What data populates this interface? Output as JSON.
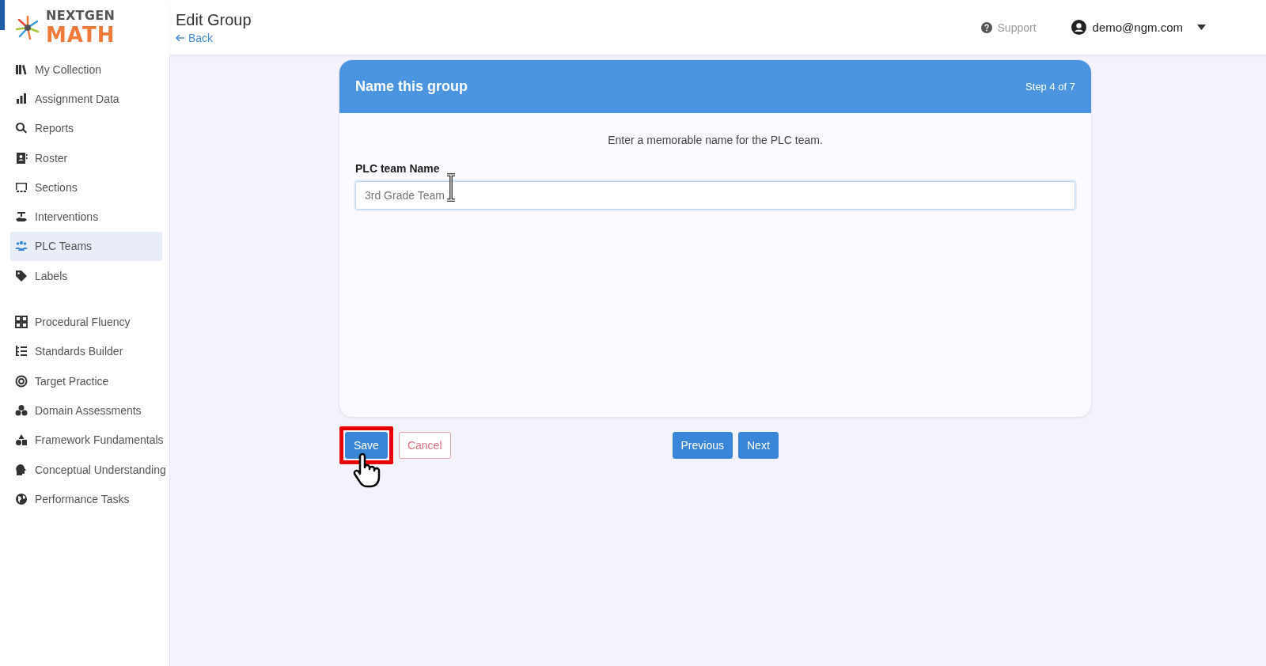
{
  "logo": {
    "line_1": "NEXTGEN",
    "line_2": "MATH"
  },
  "header": {
    "title": "Edit Group",
    "back_link": "Back",
    "support_link": "Support",
    "user_email": "demo@ngm.com"
  },
  "sidebar": {
    "groups": [
      {
        "items": [
          {
            "label": "My Collection",
            "selected": false
          },
          {
            "label": "Assignment Data",
            "selected": false
          },
          {
            "label": "Reports",
            "selected": false
          },
          {
            "label": "Roster",
            "selected": false
          },
          {
            "label": "Sections",
            "selected": false
          },
          {
            "label": "Interventions",
            "selected": false
          },
          {
            "label": "PLC Teams",
            "selected": true
          },
          {
            "label": "Labels",
            "selected": false
          }
        ]
      },
      {
        "items": [
          {
            "label": "Procedural Fluency",
            "selected": false
          },
          {
            "label": "Standards Builder",
            "selected": false
          },
          {
            "label": "Target Practice",
            "selected": false
          },
          {
            "label": "Domain Assessments",
            "selected": false
          },
          {
            "label": "Framework Fundamentals",
            "selected": false
          },
          {
            "label": "Conceptual Understanding",
            "selected": false
          },
          {
            "label": "Performance Tasks",
            "selected": false
          }
        ]
      }
    ]
  },
  "wizard": {
    "title": "Name this group",
    "step": "Step 4 of 7",
    "instructions": "Enter a memorable name for the PLC team.",
    "field_label": "PLC team Name",
    "field_value": "3rd Grade Team"
  },
  "buttons": [
    {
      "label": "Save",
      "kind": "primary",
      "highlighted": true
    },
    {
      "label": "Cancel",
      "kind": "outline",
      "highlighted": false
    },
    {
      "label": "Previous",
      "kind": "primary",
      "highlighted": false
    },
    {
      "label": "Next",
      "kind": "primary",
      "highlighted": false
    }
  ]
}
